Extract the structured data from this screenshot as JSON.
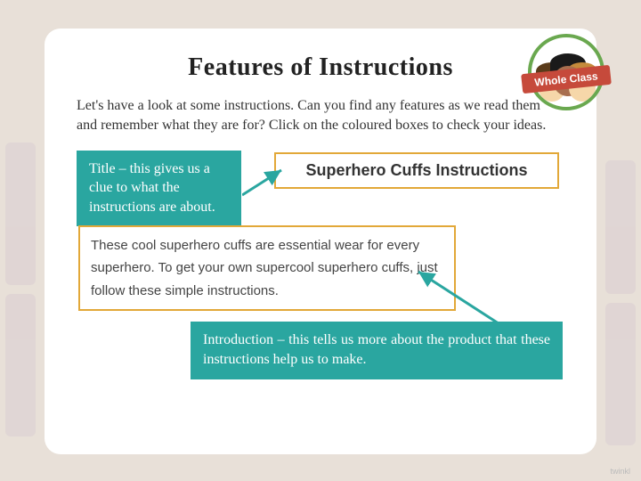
{
  "slide": {
    "title": "Features of Instructions",
    "intro": "Let's have a look at some instructions. Can you find any features as we read them and remember what they are for? Click on the coloured boxes to check your ideas.",
    "badge_label": "Whole Class",
    "example": {
      "title_text": "Superhero Cuffs Instructions",
      "intro_text": "These cool superhero cuffs are essential wear for every superhero. To get your own supercool superhero cuffs, just follow these simple instructions."
    },
    "callouts": {
      "title_explain": "Title – this gives us a clue to what the instructions are about.",
      "intro_explain": "Introduction – this tells us more about the product that these instructions help us to make."
    },
    "colors": {
      "box_border": "#e2a838",
      "callout_bg": "#2aa6a0",
      "badge_border": "#6aa84f",
      "ribbon": "#c64a3b"
    }
  }
}
